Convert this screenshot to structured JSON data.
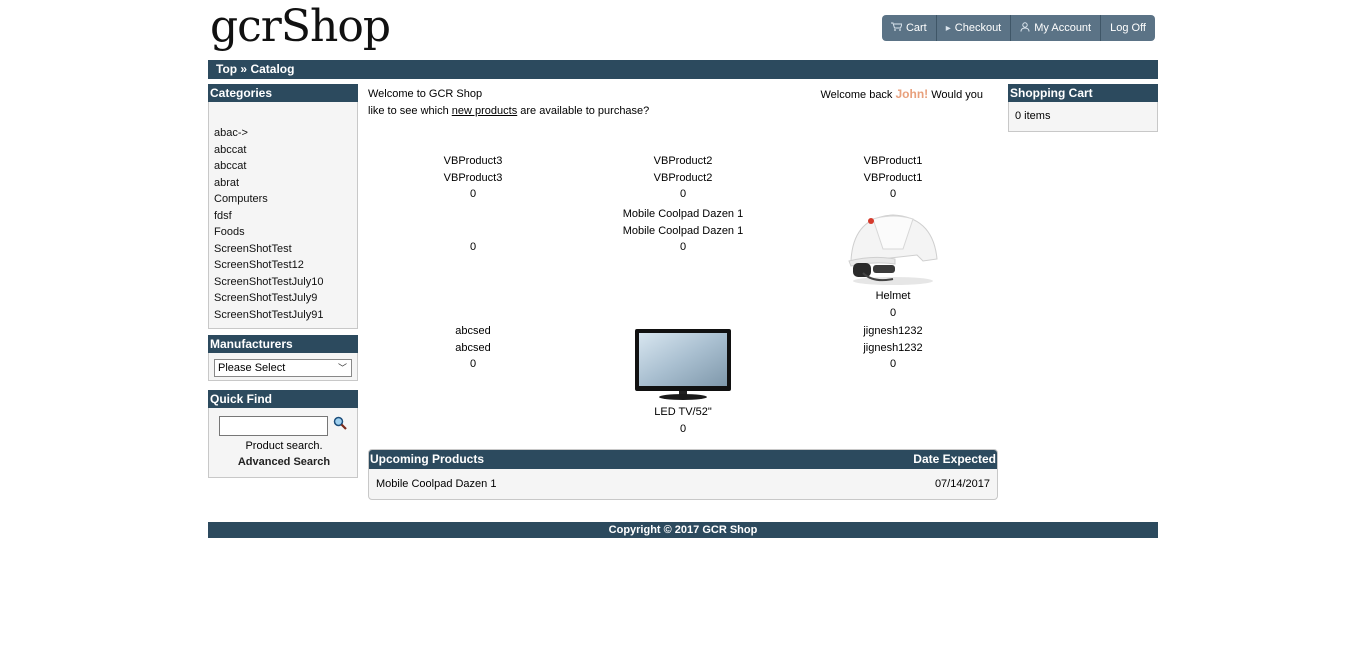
{
  "header": {
    "logo": "gcrShop",
    "nav": [
      {
        "label": "Cart",
        "icon": "cart-icon"
      },
      {
        "label": "Checkout",
        "icon": "triangle-right-icon"
      },
      {
        "label": "My Account",
        "icon": "user-icon"
      },
      {
        "label": "Log Off",
        "icon": ""
      }
    ]
  },
  "breadcrumb": "Top » Catalog",
  "categories": {
    "title": "Categories",
    "items": [
      "abac->",
      "abccat",
      "abccat",
      "abrat",
      "Computers",
      "fdsf",
      "Foods",
      "ScreenShotTest",
      "ScreenShotTest12",
      "ScreenShotTestJuly10",
      "ScreenShotTestJuly9",
      "ScreenShotTestJuly91"
    ]
  },
  "manufacturers": {
    "title": "Manufacturers",
    "selected": "Please Select"
  },
  "quick_find": {
    "title": "Quick Find",
    "value": "",
    "hint": "Product search.",
    "advanced": "Advanced Search"
  },
  "welcome": {
    "line1": "Welcome to GCR Shop",
    "back_prefix": "Welcome back ",
    "user": "John!",
    "back_suffix": " Would you",
    "line2_prefix": "like to see which ",
    "link": "new products",
    "line2_suffix": " are available to purchase?"
  },
  "products": [
    {
      "name": "VBProduct3",
      "model": "VBProduct3",
      "price": "0"
    },
    {
      "name": "VBProduct2",
      "model": "VBProduct2",
      "price": "0"
    },
    {
      "name": "VBProduct1",
      "model": "VBProduct1",
      "price": "0"
    },
    {
      "price": "0"
    },
    {
      "name": "Mobile Coolpad Dazen 1",
      "model": "Mobile Coolpad Dazen 1",
      "price": "0"
    },
    {
      "image": "helmet-image",
      "name": "Helmet",
      "price": "0"
    },
    {
      "name": "abcsed",
      "model": "abcsed",
      "price": "0"
    },
    {
      "image": "tv-image",
      "name": "LED TV/52\"",
      "price": "0"
    },
    {
      "name": "jignesh1232",
      "model": "jignesh1232",
      "price": "0"
    }
  ],
  "upcoming": {
    "title": "Upcoming Products",
    "date_header": "Date Expected",
    "rows": [
      {
        "name": "Mobile Coolpad Dazen 1",
        "date": "07/14/2017"
      }
    ]
  },
  "cart": {
    "title": "Shopping Cart",
    "summary": "0 items"
  },
  "footer": "Copyright © 2017 GCR Shop"
}
